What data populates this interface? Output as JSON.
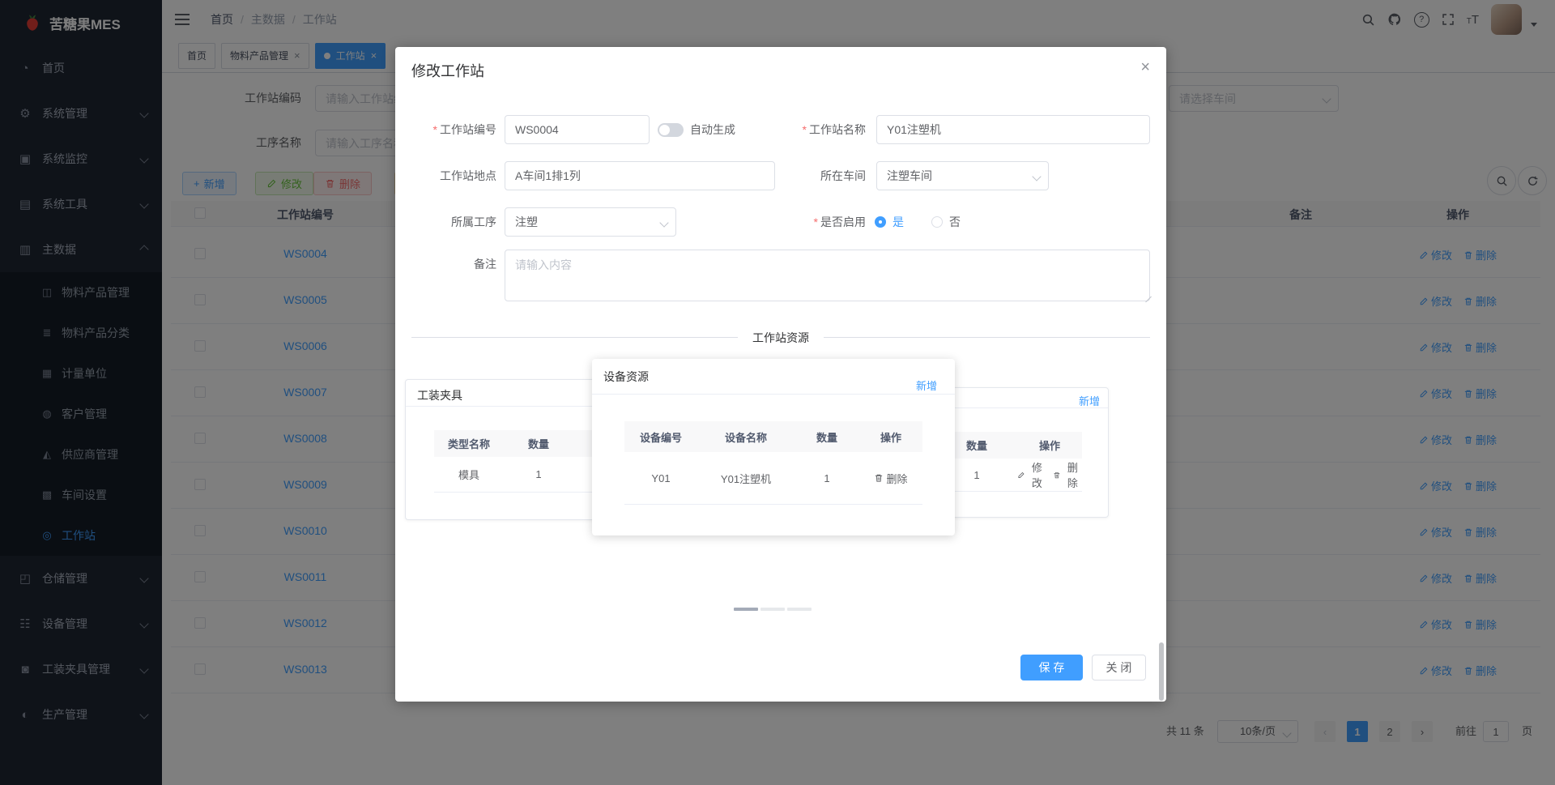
{
  "app": {
    "logo_text": "苦糖果MES"
  },
  "sidebar": {
    "menu": [
      {
        "label": "首页"
      },
      {
        "label": "系统管理"
      },
      {
        "label": "系统监控"
      },
      {
        "label": "系统工具"
      },
      {
        "label": "主数据"
      }
    ],
    "submenu": [
      {
        "label": "物料产品管理"
      },
      {
        "label": "物料产品分类"
      },
      {
        "label": "计量单位"
      },
      {
        "label": "客户管理"
      },
      {
        "label": "供应商管理"
      },
      {
        "label": "车间设置"
      },
      {
        "label": "工作站"
      }
    ],
    "menu_bottom": [
      {
        "label": "仓储管理"
      },
      {
        "label": "设备管理"
      },
      {
        "label": "工装夹具管理"
      },
      {
        "label": "生产管理"
      }
    ]
  },
  "topbar": {
    "breadcrumb": [
      "首页",
      "主数据",
      "工作站"
    ],
    "separator": "/"
  },
  "tabs": [
    {
      "label": "首页"
    },
    {
      "label": "物料产品管理",
      "close": "×"
    },
    {
      "label": "工作站",
      "close": "×"
    }
  ],
  "filters": {
    "station_code_label": "工作站编码",
    "station_code_placeholder": "请输入工作站编码",
    "process_name_label": "工序名称",
    "process_name_placeholder": "请输入工序名称",
    "workshop_placeholder": "请选择车间"
  },
  "toolbar": {
    "add": "新增",
    "edit": "修改",
    "delete": "删除"
  },
  "table": {
    "headers": {
      "station_code": "工作站编号",
      "remark": "备注",
      "actions": "操作"
    },
    "row_actions": {
      "edit": "修改",
      "delete": "删除"
    },
    "rows": [
      "WS0004",
      "WS0005",
      "WS0006",
      "WS0007",
      "WS0008",
      "WS0009",
      "WS0010",
      "WS0011",
      "WS0012",
      "WS0013"
    ]
  },
  "pagination": {
    "total": "共 11 条",
    "page_size": "10条/页",
    "prev": "‹",
    "next": "›",
    "pages": [
      "1",
      "2"
    ],
    "goto_label": "前往",
    "goto_value": "1",
    "page_label": "页"
  },
  "modal": {
    "title": "修改工作站",
    "close": "×",
    "required_mark": "*",
    "fields": {
      "code_label": "工作站编号",
      "code_value": "WS0004",
      "auto_generate": "自动生成",
      "name_label": "工作站名称",
      "name_value": "Y01注塑机",
      "location_label": "工作站地点",
      "location_value": "A车间1排1列",
      "workshop_label": "所在车间",
      "workshop_value": "注塑车间",
      "process_label": "所属工序",
      "process_value": "注塑",
      "enabled_label": "是否启用",
      "enabled_yes": "是",
      "enabled_no": "否",
      "remark_label": "备注",
      "remark_placeholder": "请输入内容"
    },
    "divider": "工作站资源",
    "fixture_card": {
      "title": "工装夹具",
      "col_type": "类型名称",
      "col_qty": "数量",
      "row_type": "模具",
      "row_qty": "1"
    },
    "device_card": {
      "title": "设备资源",
      "add": "新增",
      "col_code": "设备编号",
      "col_name": "设备名称",
      "col_qty": "数量",
      "col_actions": "操作",
      "row_code": "Y01",
      "row_name": "Y01注塑机",
      "row_qty": "1",
      "delete": "删除"
    },
    "right_card": {
      "add": "新增",
      "col_qty": "数量",
      "col_actions": "操作",
      "row_qty": "1",
      "edit": "修改",
      "delete": "删除"
    },
    "footer": {
      "save": "保 存",
      "close": "关 闭"
    }
  },
  "colors": {
    "accent": "#409eff",
    "success": "#67c23a",
    "danger": "#f56c6c",
    "sidebar_bg": "#1f2633"
  }
}
